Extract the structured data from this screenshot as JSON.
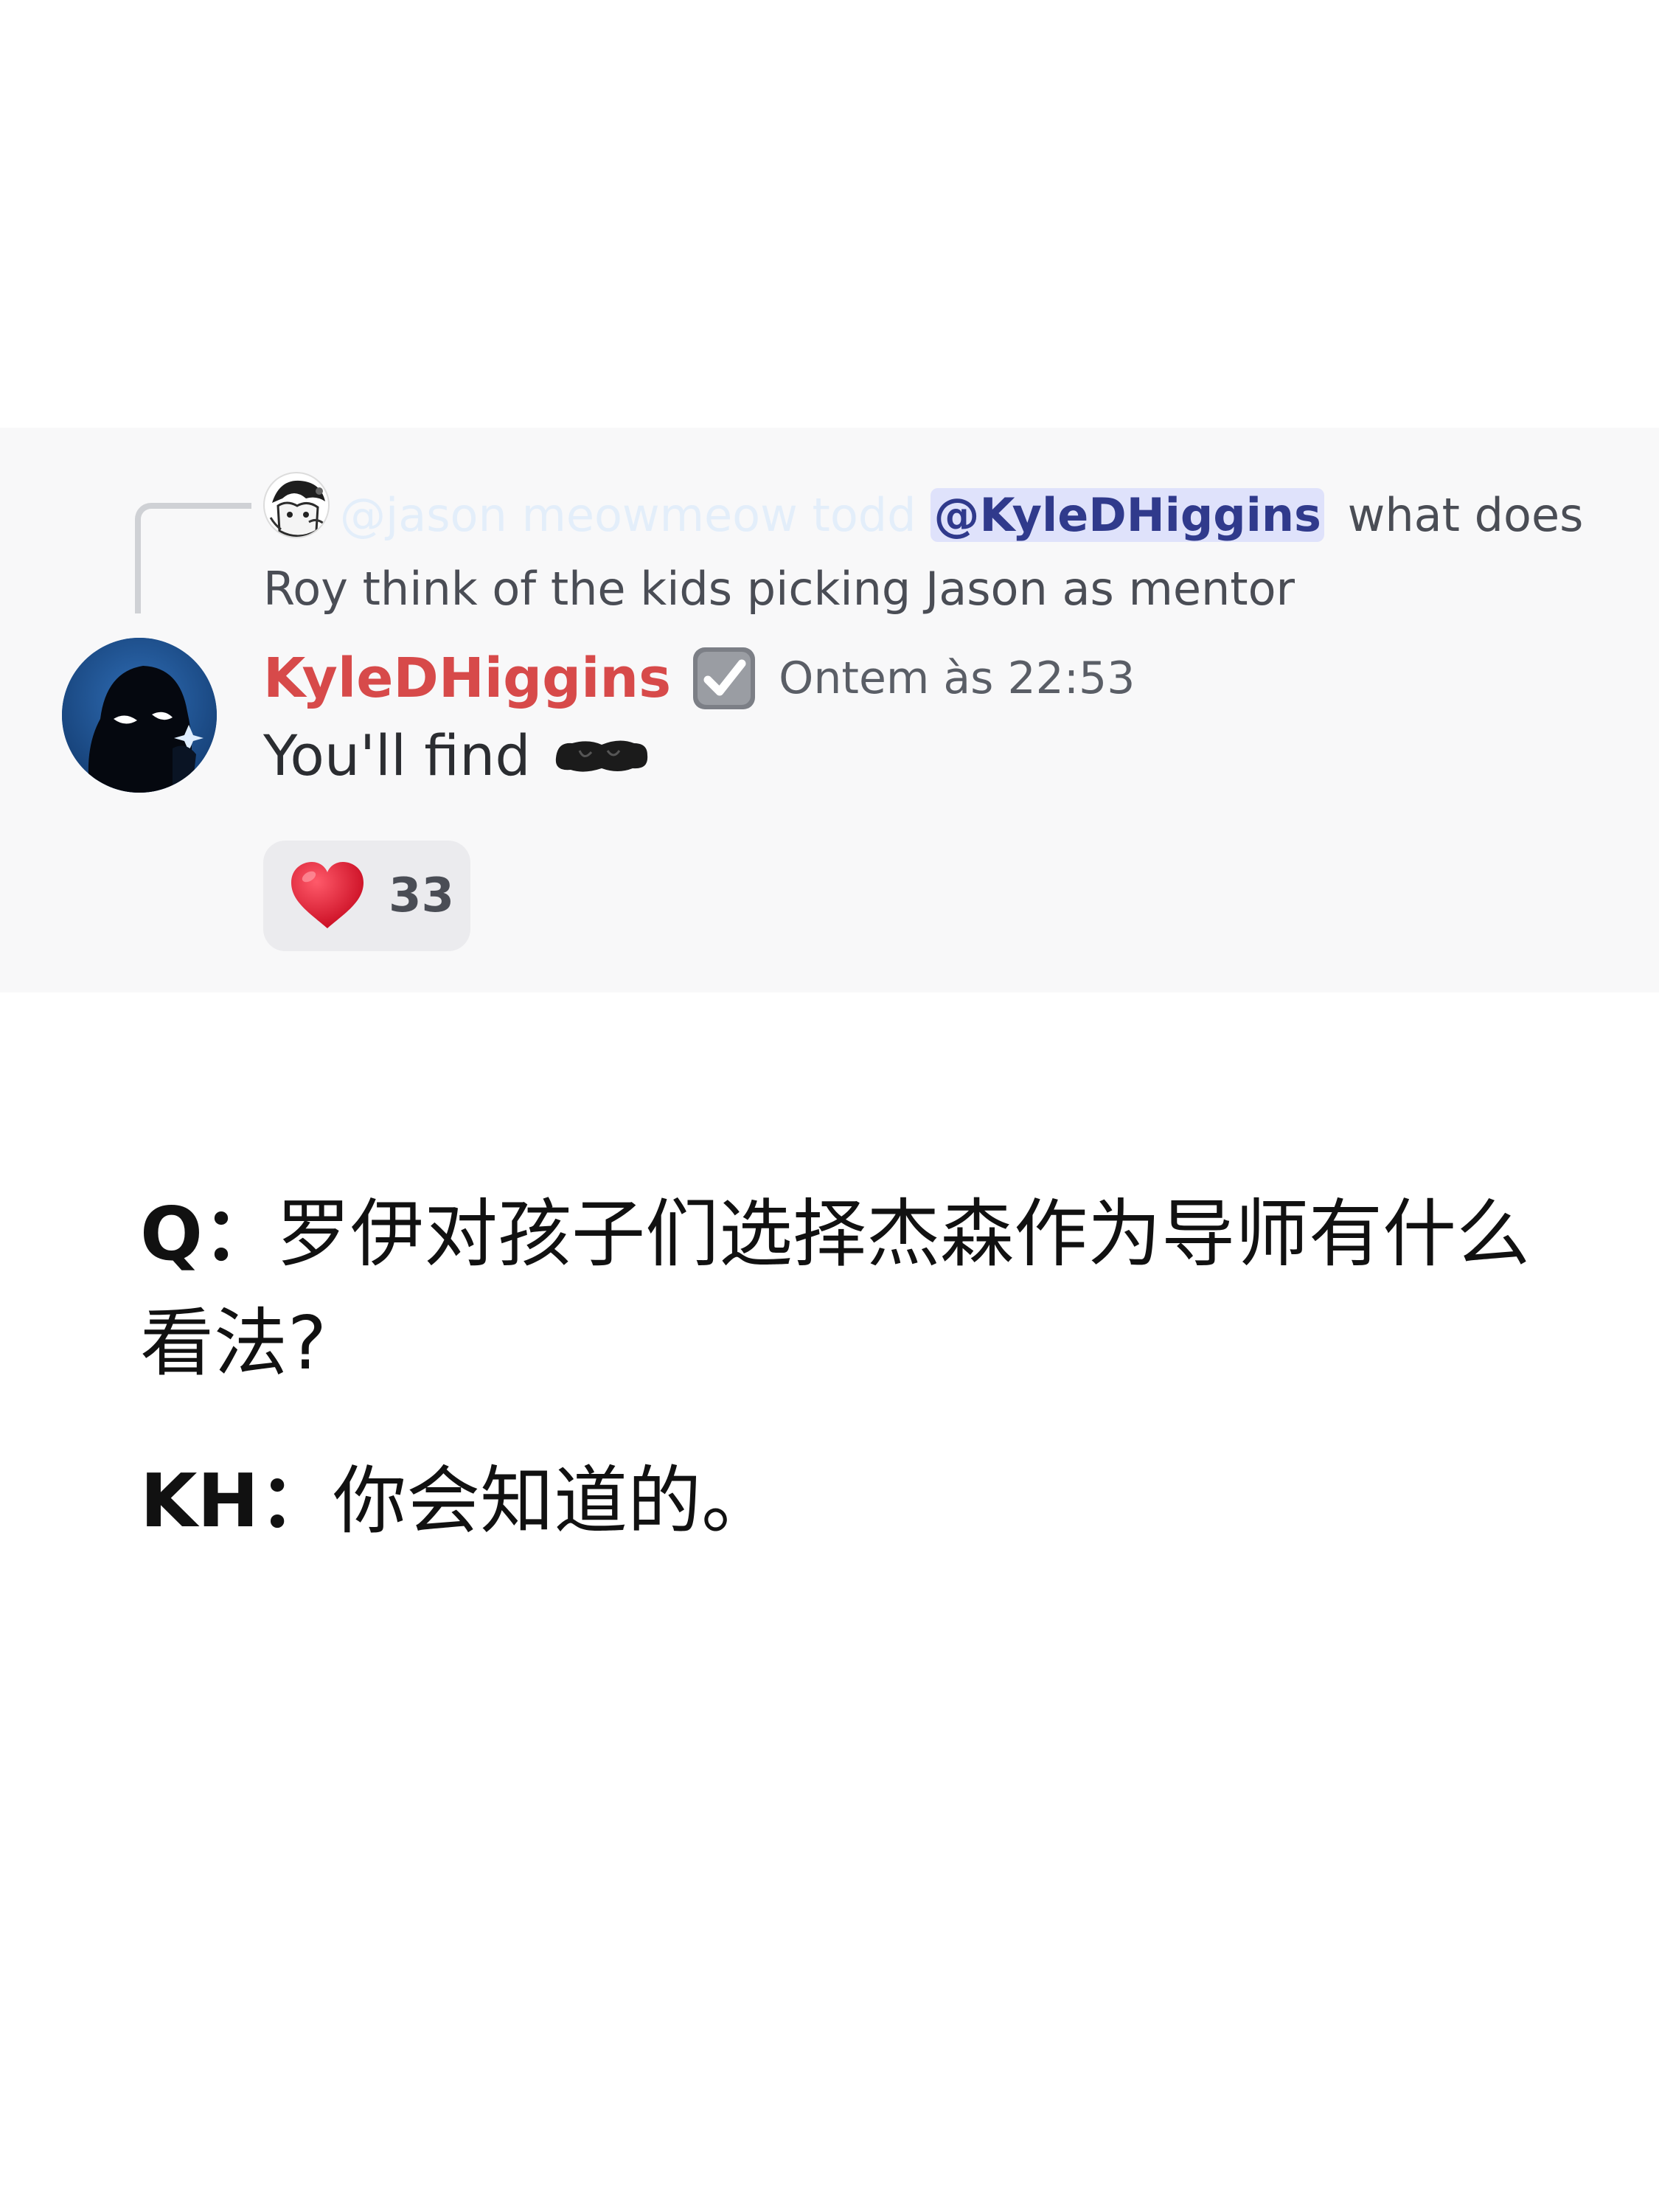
{
  "reply": {
    "author": "@jason meowmeow todd",
    "mention": "@KyleDHiggins",
    "text_after_mention": " what does Roy think of the kids picking Jason as mentor"
  },
  "message": {
    "author": "KyleDHiggins",
    "timestamp": "Ontem às 22:53",
    "text": "You'll find"
  },
  "reaction": {
    "emoji_icon": "heart-icon",
    "count": "33"
  },
  "translation": {
    "q_label": "Q：",
    "q_text": "罗伊对孩子们选择杰森作为导师有什么看法?",
    "a_label": "KH：",
    "a_text": "你会知道的。"
  },
  "colors": {
    "author_name": "#d74a4a",
    "mention_text": "#303a8c",
    "mention_bg": "#dfe2fb",
    "message_bg": "#f8f8f9",
    "heart": "#e0142b"
  }
}
